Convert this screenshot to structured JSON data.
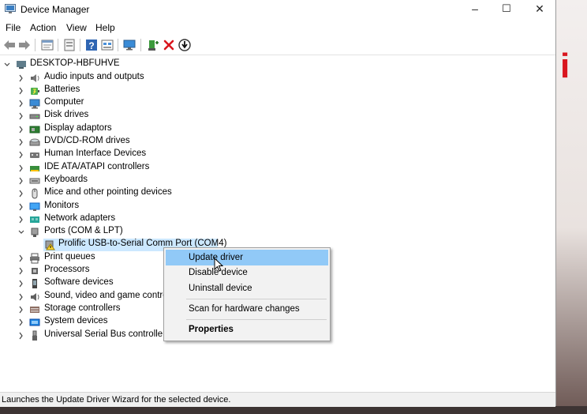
{
  "window": {
    "title": "Device Manager",
    "controls": {
      "minimize": "–",
      "maximize": "☐",
      "close": "✕"
    }
  },
  "menu": [
    "File",
    "Action",
    "View",
    "Help"
  ],
  "toolbar_icons": [
    "back-arrow-icon",
    "forward-arrow-icon",
    "properties-sheet-icon",
    "show-hidden-icon",
    "help-icon",
    "resources-view-icon",
    "monitor-scan-icon",
    "add-driver-icon",
    "uninstall-x-icon",
    "download-driver-icon"
  ],
  "colors": {
    "selection": "#cce8ff",
    "menu_highlight": "#91c9f7",
    "uninstall_red": "#d9161e"
  },
  "tree": {
    "root": "DESKTOP-HBFUHVE",
    "categories": [
      {
        "label": "Audio inputs and outputs",
        "icon": "speaker-icon"
      },
      {
        "label": "Batteries",
        "icon": "battery-icon"
      },
      {
        "label": "Computer",
        "icon": "computer-icon"
      },
      {
        "label": "Disk drives",
        "icon": "disk-drive-icon"
      },
      {
        "label": "Display adaptors",
        "icon": "display-adapter-icon"
      },
      {
        "label": "DVD/CD-ROM drives",
        "icon": "dvd-drive-icon"
      },
      {
        "label": "Human Interface Devices",
        "icon": "hid-icon"
      },
      {
        "label": "IDE ATA/ATAPI controllers",
        "icon": "ide-controller-icon"
      },
      {
        "label": "Keyboards",
        "icon": "keyboard-icon"
      },
      {
        "label": "Mice and other pointing devices",
        "icon": "mouse-icon"
      },
      {
        "label": "Monitors",
        "icon": "monitor-icon"
      },
      {
        "label": "Network adapters",
        "icon": "network-adapter-icon"
      },
      {
        "label": "Ports (COM & LPT)",
        "icon": "port-icon",
        "expanded": true
      },
      {
        "label": "Print queues",
        "icon": "printer-icon"
      },
      {
        "label": "Processors",
        "icon": "processor-icon"
      },
      {
        "label": "Software devices",
        "icon": "software-device-icon"
      },
      {
        "label": "Sound, video and game controllers",
        "icon": "sound-icon"
      },
      {
        "label": "Storage controllers",
        "icon": "storage-icon"
      },
      {
        "label": "System devices",
        "icon": "system-device-icon"
      },
      {
        "label": "Universal Serial Bus controllers",
        "icon": "usb-icon"
      }
    ],
    "port_child": {
      "label": "Prolific USB-to-Serial Comm Port (COM4)",
      "icon": "warning-port-icon"
    }
  },
  "context_menu": {
    "items": [
      {
        "label": "Update driver",
        "highlighted": true
      },
      {
        "label": "Disable device"
      },
      {
        "label": "Uninstall device"
      },
      {
        "label": "Scan for hardware changes"
      },
      {
        "label": "Properties",
        "bold": true
      }
    ]
  },
  "status_bar": "Launches the Update Driver Wizard for the selected device."
}
